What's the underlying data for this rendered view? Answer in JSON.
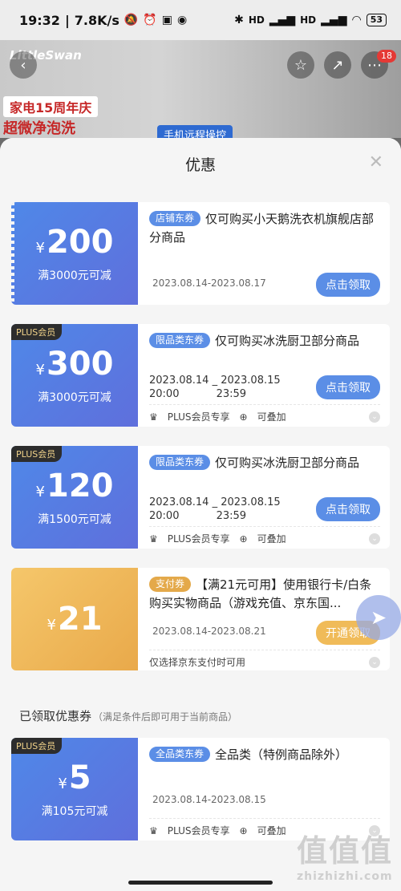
{
  "status_bar": {
    "time": "19:32",
    "speed": "7.8K/s",
    "battery": "53",
    "hd_label": "HD"
  },
  "banner": {
    "brand": "LittleSwan",
    "anniversary": "家电15周年庆",
    "feature": "超微净泡洗",
    "remote": "手机远程操控",
    "notif_count": "18"
  },
  "sheet": {
    "title": "优惠",
    "close_icon": "close-icon"
  },
  "coupons": [
    {
      "yen": "¥",
      "amount": "200",
      "condition": "满3000元可减",
      "tag": "店铺东券",
      "title": "仅可购买小天鹅洗衣机旗舰店部分商品",
      "dates": "2023.08.14-2023.08.17",
      "action": "点击领取",
      "plus": ""
    },
    {
      "yen": "¥",
      "amount": "300",
      "condition": "满3000元可减",
      "tag": "限品类东券",
      "title": "仅可购买冰洗厨卫部分商品",
      "start": "2023.08.14",
      "start_time": "20:00",
      "sep": "_",
      "end": "2023.08.15",
      "end_time": "23:59",
      "action": "点击领取",
      "plus": "PLUS会员",
      "meta1": "PLUS会员专享",
      "meta2": "可叠加"
    },
    {
      "yen": "¥",
      "amount": "120",
      "condition": "满1500元可减",
      "tag": "限品类东券",
      "title": "仅可购买冰洗厨卫部分商品",
      "start": "2023.08.14",
      "start_time": "20:00",
      "sep": "_",
      "end": "2023.08.15",
      "end_time": "23:59",
      "action": "点击领取",
      "plus": "PLUS会员",
      "meta1": "PLUS会员专享",
      "meta2": "可叠加"
    },
    {
      "yen": "¥",
      "amount": "21",
      "condition": "",
      "tag": "支付券",
      "title": "【满21元可用】使用银行卡/白条购买实物商品（游戏充值、京东国...",
      "dates": "2023.08.14-2023.08.21",
      "action": "开通领取",
      "plus": "",
      "meta1": "仅选择京东支付时可用"
    }
  ],
  "claimed_section": {
    "title": "已领取优惠券",
    "subtitle": "（满足条件后即可用于当前商品）"
  },
  "claimed": [
    {
      "yen": "¥",
      "amount": "5",
      "condition": "满105元可减",
      "tag": "全品类东券",
      "title": "全品类（特例商品除外）",
      "dates": "2023.08.14-2023.08.15",
      "plus": "PLUS会员",
      "meta1": "PLUS会员专享",
      "meta2": "可叠加"
    }
  ],
  "watermark": {
    "big": "值值值",
    "small": "zhizhizhi.com"
  },
  "colors": {
    "accent_blue": "#5b8ee6",
    "gold": "#e9a94a",
    "plus_bg": "#2d2d2d"
  }
}
